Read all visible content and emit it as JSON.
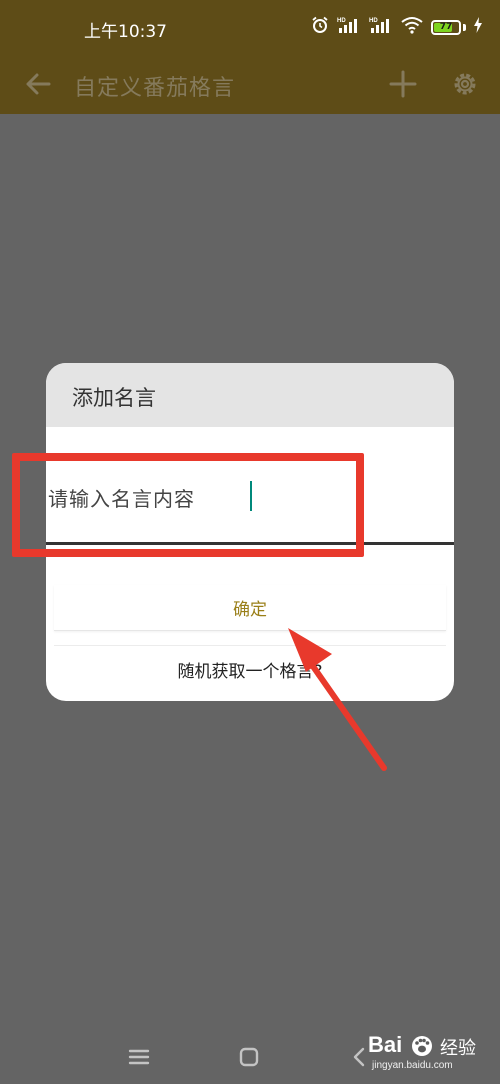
{
  "status_bar": {
    "time": "上午10:37",
    "battery_level": "77",
    "battery_fraction": 0.77,
    "colors": {
      "bar": "#5e4c17",
      "battery_fill": "#7ed321"
    },
    "icons": [
      "alarm-icon",
      "signal-hd-icon",
      "signal-hd-icon",
      "wifi-icon",
      "battery-icon",
      "charging-icon"
    ]
  },
  "app_bar": {
    "title": "自定义番茄格言",
    "icons": [
      "back-arrow-icon",
      "add-icon",
      "settings-gear-icon"
    ]
  },
  "dialog": {
    "title": "添加名言",
    "input": {
      "placeholder": "请输入名言内容",
      "value": ""
    },
    "confirm_label": "确定",
    "random_label": "随机获取一个格言?",
    "colors": {
      "confirm_text": "#9a7f18",
      "header_bg": "#e4e4e4",
      "caret": "#00897b"
    }
  },
  "annotations": {
    "highlight_color": "#e8392c"
  },
  "nav_bar": {
    "icons": [
      "menu-icon",
      "home-square-icon",
      "back-chevron-icon"
    ]
  },
  "watermark": {
    "brand": "Bai",
    "brand_cn": "经验",
    "url": "jingyan.baidu.com"
  }
}
